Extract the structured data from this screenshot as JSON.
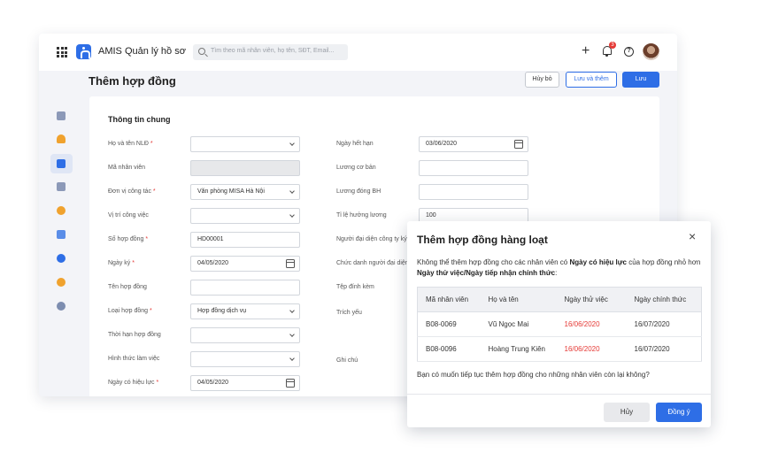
{
  "app": {
    "title": "AMIS Quản lý hồ sơ"
  },
  "search": {
    "placeholder": "Tìm theo mã nhân viên, họ tên, SĐT, Email..."
  },
  "header": {
    "notification_count": "3",
    "plus": "+",
    "help": "?"
  },
  "page": {
    "title": "Thêm hợp đồng",
    "cancel_label": "Hủy bỏ",
    "save_add_label": "Lưu và thêm",
    "save_label": "Lưu"
  },
  "sidebar": {
    "expand": "»"
  },
  "form": {
    "section_title": "Thông tin chung",
    "left": [
      {
        "label": "Họ và tên NLĐ",
        "required": "*",
        "value": "",
        "kind": "select"
      },
      {
        "label": "Mã nhân viên",
        "required": "",
        "value": "",
        "kind": "disabled"
      },
      {
        "label": "Đơn vị công tác",
        "required": "*",
        "value": "Văn phòng MISA Hà Nội",
        "kind": "select"
      },
      {
        "label": "Vị trí công việc",
        "required": "",
        "value": "",
        "kind": "select"
      },
      {
        "label": "Số hợp đồng",
        "required": "*",
        "value": "HD00001",
        "kind": "text"
      },
      {
        "label": "Ngày ký",
        "required": "*",
        "value": "04/05/2020",
        "kind": "date"
      },
      {
        "label": "Tên hợp đồng",
        "required": "",
        "value": "",
        "kind": "text"
      },
      {
        "label": "Loại hợp đồng",
        "required": "*",
        "value": "Hợp đồng dịch vụ",
        "kind": "select"
      },
      {
        "label": "Thời hạn hợp đồng",
        "required": "",
        "value": "",
        "kind": "select"
      },
      {
        "label": "Hình thức làm việc",
        "required": "",
        "value": "",
        "kind": "select"
      },
      {
        "label": "Ngày có hiệu lực",
        "required": "*",
        "value": "04/05/2020",
        "kind": "date"
      }
    ],
    "right": [
      {
        "label": "Ngày hết hạn",
        "value": "03/06/2020",
        "kind": "date"
      },
      {
        "label": "Lương cơ bản",
        "value": "",
        "kind": "text"
      },
      {
        "label": "Lương đóng BH",
        "value": "",
        "kind": "text"
      },
      {
        "label": "Tỉ lệ hưởng lương",
        "value": "100",
        "kind": "text"
      },
      {
        "label": "Người đại diện công ty ký"
      },
      {
        "label": "Chức danh người đại diện"
      },
      {
        "label": "Tệp đính kèm"
      },
      {
        "label": "Trích yếu"
      },
      {
        "label": "Ghi chú"
      }
    ]
  },
  "dialog": {
    "title": "Thêm hợp đồng hàng loạt",
    "close": "×",
    "msg_part1": "Không thể thêm hợp đồng cho các nhân viên có ",
    "msg_bold1": "Ngày có hiệu lực",
    "msg_part2": " của hợp đồng nhỏ hơn ",
    "msg_bold2": "Ngày thử việc/Ngày tiếp nhận chính thức",
    "msg_part3": ":",
    "columns": [
      "Mã nhân viên",
      "Họ và tên",
      "Ngày thử việc",
      "Ngày chính thức"
    ],
    "rows": [
      {
        "code": "B08-0069",
        "name": "Vũ Ngọc Mai",
        "trial": "16/06/2020",
        "official": "16/07/2020"
      },
      {
        "code": "B08-0096",
        "name": "Hoàng Trung Kiên",
        "trial": "16/06/2020",
        "official": "16/07/2020"
      }
    ],
    "question": "Bạn có muốn tiếp tục thêm hợp đồng cho những nhân viên còn lại không?",
    "cancel_label": "Hủy",
    "ok_label": "Đồng ý"
  },
  "colors": {
    "accent": "#2e6ee6",
    "danger": "#e53935"
  }
}
